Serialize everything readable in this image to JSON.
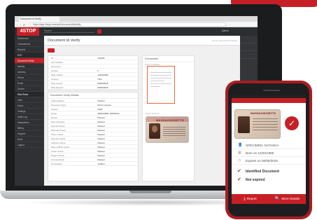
{
  "browser": {
    "tab_title": "Document Id Verify",
    "url": "https://app.4stop.example/document/identity"
  },
  "header": {
    "logo": "4STOP",
    "search_placeholder": "Search",
    "user": "Admin"
  },
  "sidebar": {
    "items": [
      {
        "label": "Dashboard"
      },
      {
        "label": "Transactions"
      },
      {
        "label": "Reports"
      },
      {
        "label": "KYC"
      },
      {
        "label": "Document Verify"
      },
      {
        "label": "Identity"
      },
      {
        "label": "Address"
      },
      {
        "label": "Phone"
      },
      {
        "label": "Email"
      },
      {
        "label": "Device"
      },
      {
        "label": "Risk Rules"
      },
      {
        "label": "Lists"
      },
      {
        "label": "Users"
      },
      {
        "label": "Settings"
      },
      {
        "label": "Audit Log"
      },
      {
        "label": "Integrations"
      },
      {
        "label": "Billing"
      },
      {
        "label": "Support"
      },
      {
        "label": "Docs"
      },
      {
        "label": "Logout"
      }
    ]
  },
  "main": {
    "page_title": "Document Id Verify",
    "breadcrumb": "Home / Document Id Verify",
    "details_rows": [
      {
        "k": "ID",
        "v": "123456"
      },
      {
        "k": "Last Verified",
        "v": ""
      },
      {
        "k": "Document",
        "v": ""
      },
      {
        "k": "Gender",
        "v": "F"
      },
      {
        "k": "Date of Birth",
        "v": "12/03/1986"
      },
      {
        "k": "Country",
        "v": "USA"
      },
      {
        "k": "Date Issued",
        "v": "06/05/2018"
      },
      {
        "k": "Date Expired",
        "v": "06/05/2025"
      }
    ],
    "verify_card_title": "Document Verify Details",
    "verify_rows": [
      {
        "k": "Authentication",
        "v": "Passed"
      },
      {
        "k": "Document Type",
        "v": "Driver License"
      },
      {
        "k": "Version",
        "v": "2018"
      },
      {
        "k": "Name",
        "v": "SPECIMEN, NATASHA"
      },
      {
        "k": "Result",
        "v": "Passed"
      },
      {
        "k": "Date Checked",
        "v": "Passed"
      },
      {
        "k": "Expired Check",
        "v": "Passed"
      },
      {
        "k": "Barcode Check",
        "v": "Passed"
      },
      {
        "k": "Photo Check",
        "v": "Passed"
      },
      {
        "k": "Security Check",
        "v": "Passed"
      },
      {
        "k": "Address Check",
        "v": "Passed"
      },
      {
        "k": "Date of Birth Check",
        "v": "Passed"
      },
      {
        "k": "Issuer Check",
        "v": "Passed"
      },
      {
        "k": "Region Check",
        "v": "Passed"
      },
      {
        "k": "Format Check",
        "v": "Passed"
      },
      {
        "k": "Final Status",
        "v": "Verified"
      }
    ],
    "documents_title": "Documents",
    "documents_sub": "Proof of Identity",
    "id_sub": "Photo ID Front",
    "id_state": "MASSACHUSETTS"
  },
  "phone": {
    "name": "SPECIMEN, NATASHA",
    "born": "Born on 12/03/1986",
    "expires": "Expires on 06/05/2025",
    "check1": "Identified Document",
    "check2": "Not expired",
    "report_label": "Report",
    "more_label": "More Details",
    "id_state": "MASSACHUSETTS"
  },
  "colors": {
    "accent": "#c62026",
    "dark": "#2b2d30"
  }
}
